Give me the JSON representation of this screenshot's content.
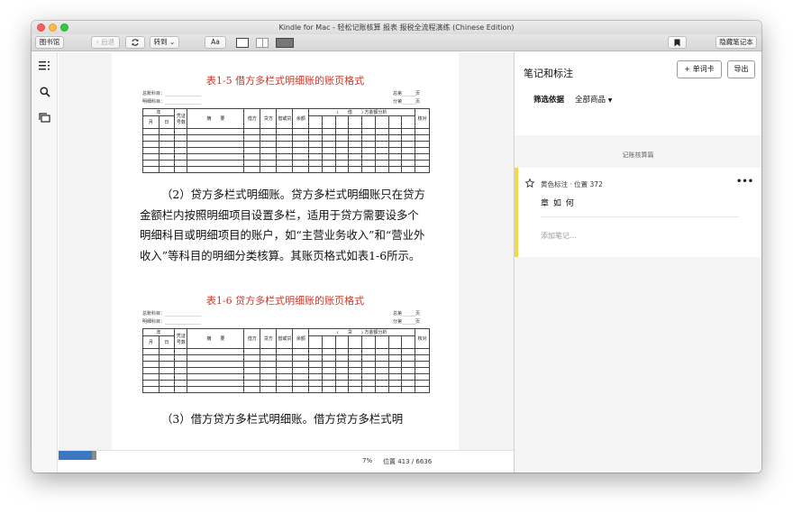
{
  "window": {
    "title": "Kindle for Mac - 轻松记账核算 报表 报税全流程演练 (Chinese Edition)"
  },
  "toolbar": {
    "library_label": "图书馆",
    "back_label": "后退",
    "goto_label": "转到",
    "font_label": "Aa",
    "hide_notebook_label": "隐藏笔记本"
  },
  "page": {
    "table5_title": "表1-5 借方多栏式明细账的账页格式",
    "table6_title": "表1-6 贷方多栏式明细账的账页格式",
    "general_account": "总账科目：________________",
    "detail_account": "明细科目：________________",
    "total_page": "总第______页",
    "sub_page": "分第______页",
    "table5_headers": [
      "年",
      "凭证号数",
      "摘　　要",
      "借方",
      "贷方",
      "借或贷",
      "余额",
      "(　　借　　) 方金额分析",
      "核对"
    ],
    "table5_subheaders": [
      "月",
      "日"
    ],
    "table6_headers": [
      "年",
      "凭证号数",
      "摘　　要",
      "借方",
      "贷方",
      "借或贷",
      "余额",
      "(　　贷　　) 方金额分析",
      "核对"
    ],
    "table6_subheaders": [
      "月",
      "日"
    ],
    "paragraph1": "（2）贷方多栏式明细账。贷方多栏式明细账只在贷方金额栏内按照明细项目设置多栏，适用于贷方需要设多个明细科目或明细项目的账户，如“主营业务收入”和“营业外收入”等科目的明细分类核算。其账页格式如表1-6所示。",
    "paragraph2": "（3）借方贷方多栏式明细账。借方贷方多栏式明"
  },
  "status": {
    "percent": "7%",
    "location": "位置 413 / 6636",
    "progress_fraction": 0.07
  },
  "notes": {
    "title": "笔记和标注",
    "flashcards_label": "+ 单词卡",
    "export_label": "导出",
    "filter_label": "筛选依据",
    "filter_value": "全部商品",
    "section_title": "记账核算篇",
    "highlight": {
      "meta": "黄色标注 · 位置 372",
      "text": "章 如 何",
      "add_note_placeholder": "添加笔记..."
    }
  },
  "colors": {
    "highlight_yellow": "#f0d84a",
    "title_red": "#c0392b",
    "progress_blue": "#3a78c2"
  }
}
